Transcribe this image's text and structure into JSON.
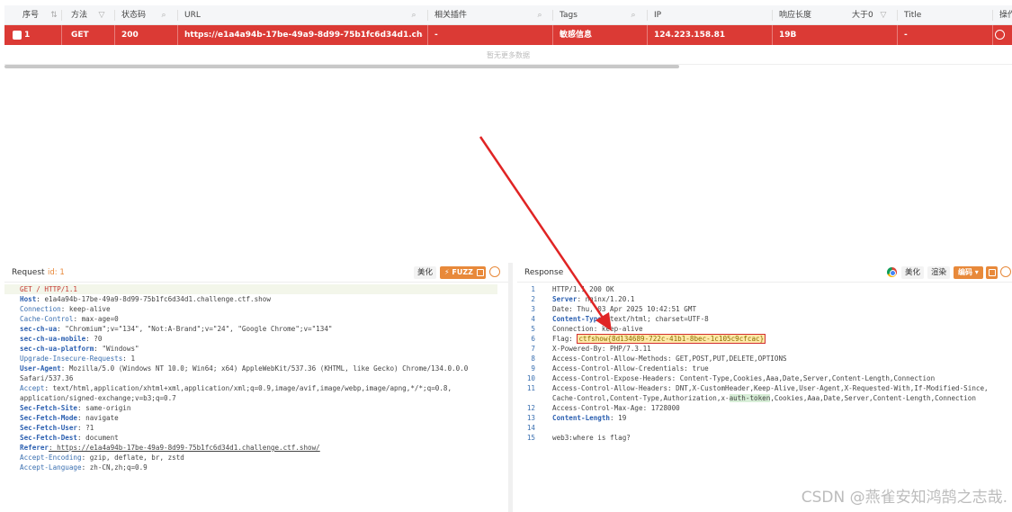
{
  "table": {
    "headers": {
      "seq": "序号",
      "method": "方法",
      "status": "状态码",
      "url": "URL",
      "plugin": "相关插件",
      "tags": "Tags",
      "ip": "IP",
      "length": "响应长度",
      "length_filter": "大于0",
      "title": "Title",
      "action": "操作"
    },
    "rows": [
      {
        "seq": "1",
        "method": "GET",
        "status": "200",
        "url": "https://e1a4a94b-17be-49a9-8d99-75b1fc6d34d1.challenge.ctf....",
        "plugin": "-",
        "tags": "敏感信息",
        "ip": "124.223.158.81",
        "length": "19B",
        "title": "-"
      }
    ],
    "empty_text": "暂无更多数据",
    "row_color": "#db3a35"
  },
  "request": {
    "title": "Request",
    "id_label": "id: 1",
    "beautify_label": "美化",
    "fuzz_label": "⚡ FUZZ",
    "lines": [
      {
        "k": "GET / HTTP/1.1",
        "v": ""
      },
      {
        "k": "Host",
        "v": ": e1a4a94b-17be-49a9-8d99-75b1fc6d34d1.challenge.ctf.show"
      },
      {
        "k": "Connection",
        "v": ": keep-alive"
      },
      {
        "k": "Cache-Control",
        "v": ": max-age=0"
      },
      {
        "k": "sec-ch-ua",
        "v": ": \"Chromium\";v=\"134\", \"Not:A-Brand\";v=\"24\", \"Google Chrome\";v=\"134\""
      },
      {
        "k": "sec-ch-ua-mobile",
        "v": ": ?0"
      },
      {
        "k": "sec-ch-ua-platform",
        "v": ": \"Windows\""
      },
      {
        "k": "Upgrade-Insecure-Requests",
        "v": ": 1"
      },
      {
        "k": "User-Agent",
        "v": ": Mozilla/5.0 (Windows NT 10.0; Win64; x64) AppleWebKit/537.36 (KHTML, like Gecko) Chrome/134.0.0.0"
      },
      {
        "k": "",
        "v": "Safari/537.36"
      },
      {
        "k": "Accept",
        "v": ": text/html,application/xhtml+xml,application/xml;q=0.9,image/avif,image/webp,image/apng,*/*;q=0.8,"
      },
      {
        "k": "",
        "v": "application/signed-exchange;v=b3;q=0.7"
      },
      {
        "k": "Sec-Fetch-Site",
        "v": ": same-origin"
      },
      {
        "k": "Sec-Fetch-Mode",
        "v": ": navigate"
      },
      {
        "k": "Sec-Fetch-User",
        "v": ": ?1"
      },
      {
        "k": "Sec-Fetch-Dest",
        "v": ": document"
      },
      {
        "k": "Referer",
        "v": ": https://e1a4a94b-17be-49a9-8d99-75b1fc6d34d1.challenge.ctf.show/"
      },
      {
        "k": "Accept-Encoding",
        "v": ": gzip, deflate, br, zstd"
      },
      {
        "k": "Accept-Language",
        "v": ": zh-CN,zh;q=0.9"
      }
    ]
  },
  "response": {
    "title": "Response",
    "beautify_label": "美化",
    "render_label": "渲染",
    "encode_label": "编码 ▾",
    "lines": [
      {
        "n": "1",
        "k": "",
        "v": "HTTP/1.1 200 OK"
      },
      {
        "n": "2",
        "k": "Server",
        "v": ": nginx/1.20.1"
      },
      {
        "n": "3",
        "k": "",
        "v": "Date: Thu, 03 Apr 2025 10:42:51 GMT"
      },
      {
        "n": "4",
        "k": "Content-Type",
        "v": ": text/html; charset=UTF-8"
      },
      {
        "n": "5",
        "k": "",
        "v": "Connection: keep-alive"
      },
      {
        "n": "6",
        "k": "",
        "v": "Flag: "
      },
      {
        "n": "7",
        "k": "",
        "v": "X-Powered-By: PHP/7.3.11"
      },
      {
        "n": "8",
        "k": "",
        "v": "Access-Control-Allow-Methods: GET,POST,PUT,DELETE,OPTIONS"
      },
      {
        "n": "9",
        "k": "",
        "v": "Access-Control-Allow-Credentials: true"
      },
      {
        "n": "10",
        "k": "",
        "v": "Access-Control-Expose-Headers: Content-Type,Cookies,Aaa,Date,Server,Content-Length,Connection"
      },
      {
        "n": "11",
        "k": "",
        "v": "Access-Control-Allow-Headers: DNT,X-CustomHeader,Keep-Alive,User-Agent,X-Requested-With,If-Modified-Since,"
      },
      {
        "n": "",
        "k": "",
        "v": "Cache-Control,Content-Type,Authorization,x-"
      },
      {
        "n": "12",
        "k": "",
        "v": "Access-Control-Max-Age: 1728000"
      },
      {
        "n": "13",
        "k": "Content-Length",
        "v": ": 19"
      },
      {
        "n": "14",
        "k": "",
        "v": ""
      },
      {
        "n": "15",
        "k": "",
        "v": "web3:where is flag?"
      }
    ],
    "flag_value": "ctfshow{8d134689-722c-41b1-8bec-1c105c9cfcac}",
    "auth_token": "auth-token",
    "after_token": ",Cookies,Aaa,Date,Server,Content-Length,Connection"
  },
  "watermark": "CSDN @燕雀安知鸿鹄之志哉.",
  "colors": {
    "accent": "#e8893a",
    "highlight_red": "#d32f2f",
    "arrow": "#e02424"
  }
}
